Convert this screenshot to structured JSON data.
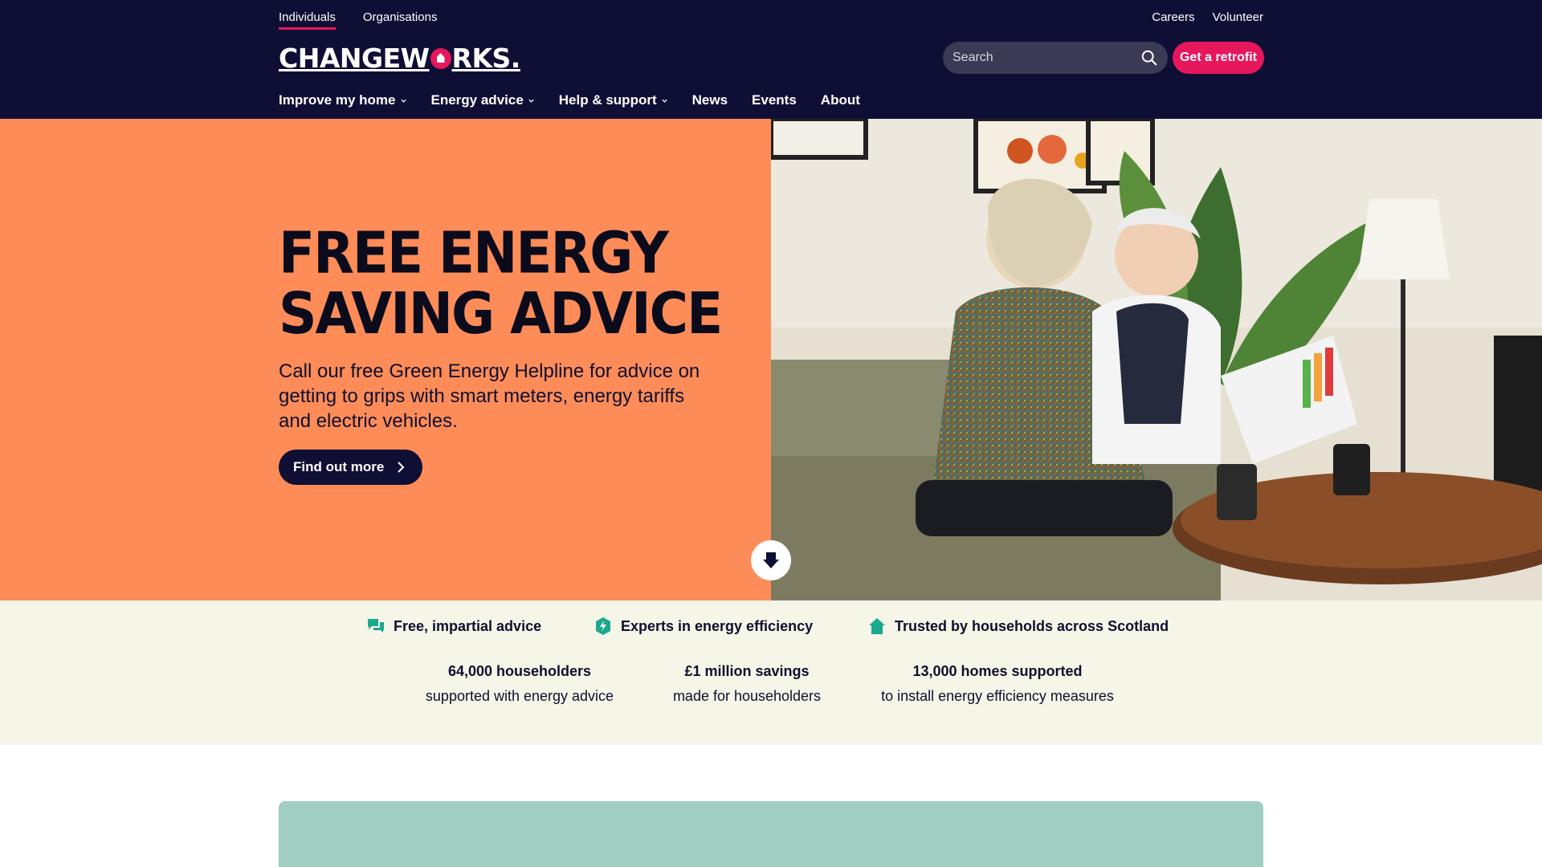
{
  "toplinks": {
    "individuals": "Individuals",
    "organisations": "Organisations",
    "careers": "Careers",
    "volunteer": "Volunteer"
  },
  "logo": {
    "left": "CHANGEW",
    "right": "RKS."
  },
  "search": {
    "placeholder": "Search"
  },
  "header": {
    "retrofit_label": "Get a retrofit"
  },
  "nav": {
    "items": [
      {
        "label": "Improve my home",
        "dropdown": true
      },
      {
        "label": "Energy advice",
        "dropdown": true
      },
      {
        "label": "Help & support",
        "dropdown": true
      },
      {
        "label": "News",
        "dropdown": false
      },
      {
        "label": "Events",
        "dropdown": false
      },
      {
        "label": "About",
        "dropdown": false
      }
    ]
  },
  "hero": {
    "title_line1": "FREE ENERGY",
    "title_line2": "SAVING ADVICE",
    "body": "Call our free Green Energy Helpline for advice on getting to grips with smart meters, energy tariffs and electric vehicles.",
    "cta_label": "Find out more"
  },
  "features": [
    {
      "label": "Free, impartial advice",
      "icon": "chat-icon"
    },
    {
      "label": "Experts in energy efficiency",
      "icon": "lightning-icon"
    },
    {
      "label": "Trusted by households across Scotland",
      "icon": "house-icon"
    }
  ],
  "stats": [
    {
      "big": "64,000 householders",
      "small": "supported with energy advice"
    },
    {
      "big": "£1 million savings",
      "small": "made for householders"
    },
    {
      "big": "13,000 homes supported",
      "small": "to install energy efficiency measures"
    }
  ],
  "colors": {
    "navy": "#0f0f35",
    "pink": "#e6175c",
    "orange": "#fd8c58",
    "cream": "#f5f5e8",
    "teal": "#1aa88e",
    "mint": "#a0cec3"
  }
}
